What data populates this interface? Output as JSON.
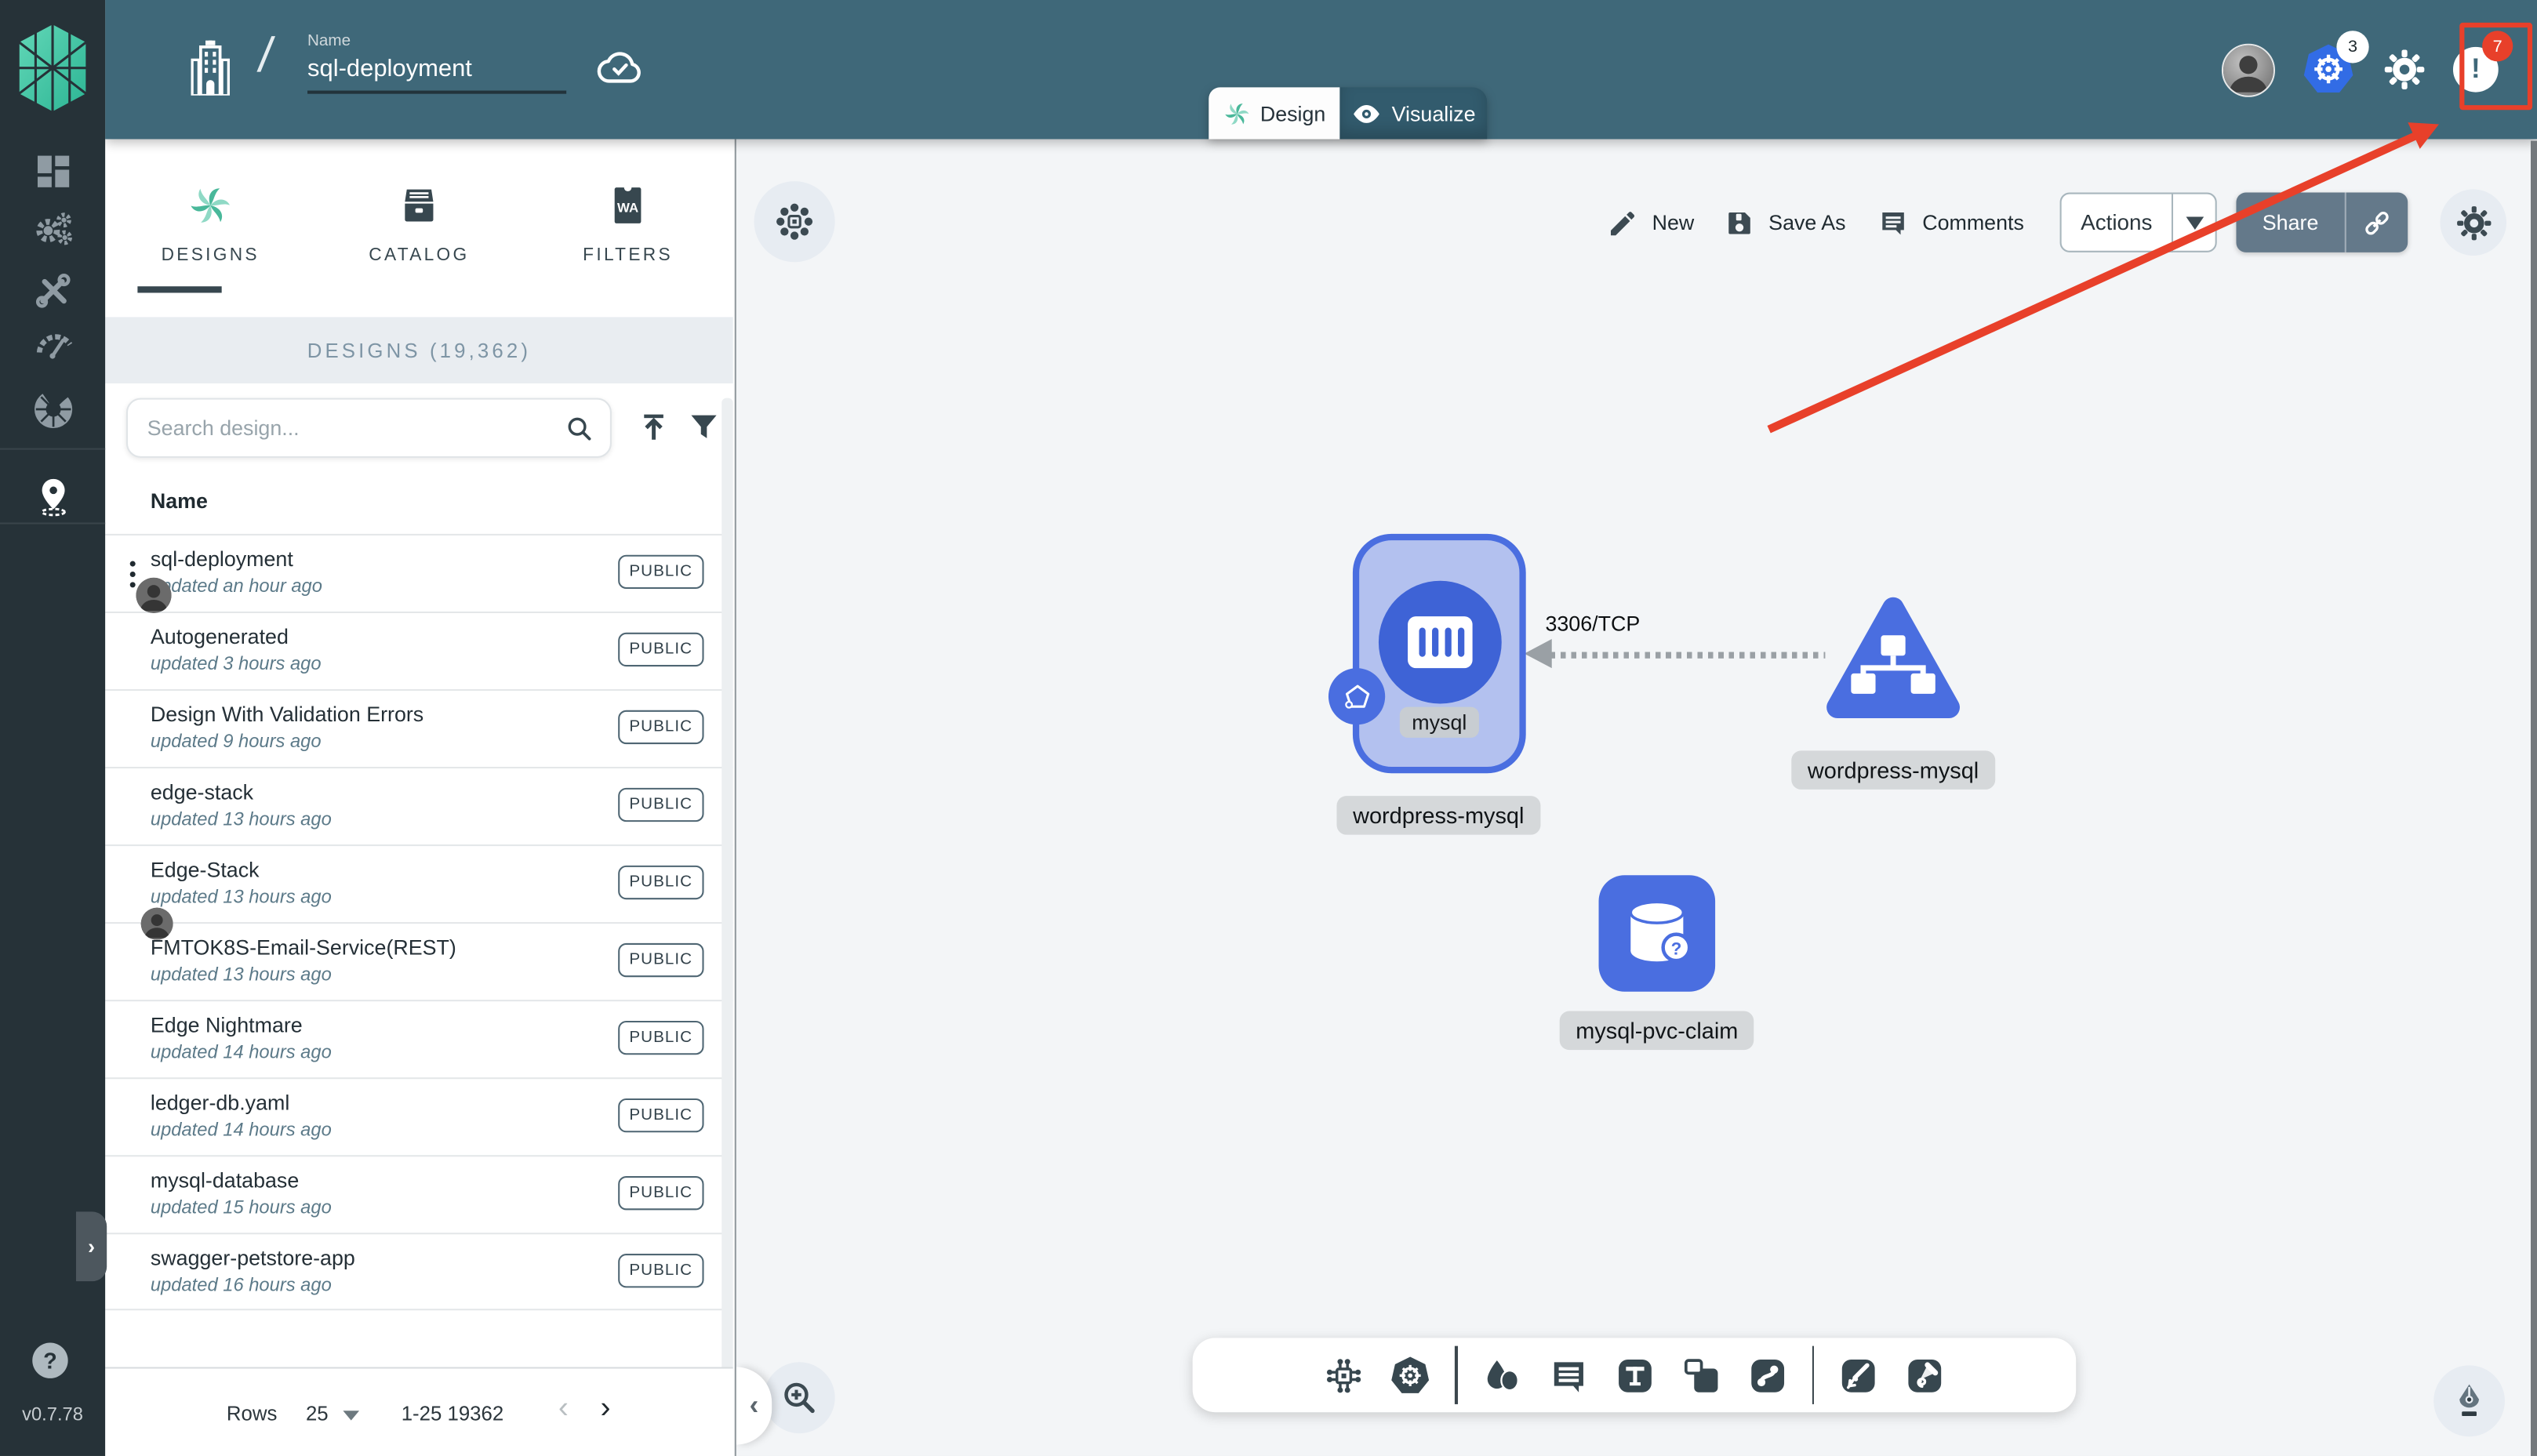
{
  "app": {
    "version": "v0.7.78"
  },
  "colors": {
    "header_teal": "#3f6879",
    "sidebar_charcoal": "#263238",
    "node_blue": "#4a6ee0",
    "annotation_red": "#e8402a",
    "brand_green": "#3cc5a4"
  },
  "header": {
    "name_label": "Name",
    "name_value": "sql-deployment",
    "mode_tabs": {
      "design": "Design",
      "visualize": "Visualize"
    },
    "kubernetes_context_count": "3",
    "notification_count": "7"
  },
  "sidebar": {
    "icons": [
      "dashboard",
      "lifecycle",
      "configuration",
      "performance",
      "extensions",
      "kanvas-pin"
    ],
    "expander": "›",
    "help": "?"
  },
  "panel": {
    "tabs": [
      {
        "label": "DESIGNS",
        "icon": "meshery-design-icon"
      },
      {
        "label": "CATALOG",
        "icon": "catalog-archive-icon"
      },
      {
        "label": "FILTERS",
        "icon": "wasm-filter-icon"
      }
    ],
    "section_title": "DESIGNS (19,362)",
    "search_placeholder": "Search design...",
    "column_header": "Name",
    "rows": [
      {
        "name": "sql-deployment",
        "updated": "updated an hour ago",
        "badge": "PUBLIC"
      },
      {
        "name": "Autogenerated",
        "updated": "updated 3 hours ago",
        "badge": "PUBLIC"
      },
      {
        "name": "Design With Validation Errors",
        "updated": "updated 9 hours ago",
        "badge": "PUBLIC"
      },
      {
        "name": "edge-stack",
        "updated": "updated 13 hours ago",
        "badge": "PUBLIC"
      },
      {
        "name": "Edge-Stack",
        "updated": "updated 13 hours ago",
        "badge": "PUBLIC"
      },
      {
        "name": "FMTOK8S-Email-Service(REST)",
        "updated": "updated 13 hours ago",
        "badge": "PUBLIC"
      },
      {
        "name": "Edge Nightmare",
        "updated": "updated 14 hours ago",
        "badge": "PUBLIC"
      },
      {
        "name": "ledger-db.yaml",
        "updated": "updated 14 hours ago",
        "badge": "PUBLIC"
      },
      {
        "name": "mysql-database",
        "updated": "updated 15 hours ago",
        "badge": "PUBLIC"
      },
      {
        "name": "swagger-petstore-app",
        "updated": "updated 16 hours ago",
        "badge": "PUBLIC"
      }
    ],
    "pagination": {
      "rows_label": "Rows",
      "per_page": "25",
      "range": "1-25 19362",
      "prev": "‹",
      "next": "›"
    }
  },
  "canvas": {
    "toolbar": {
      "new": "New",
      "save_as": "Save As",
      "comments": "Comments",
      "actions": "Actions",
      "share": "Share"
    },
    "edge": {
      "label": "3306/TCP"
    },
    "nodes": {
      "pod": {
        "chip": "mysql",
        "label": "wordpress-mysql"
      },
      "service": {
        "label": "wordpress-mysql"
      },
      "pvc": {
        "label": "mysql-pvc-claim"
      }
    }
  }
}
